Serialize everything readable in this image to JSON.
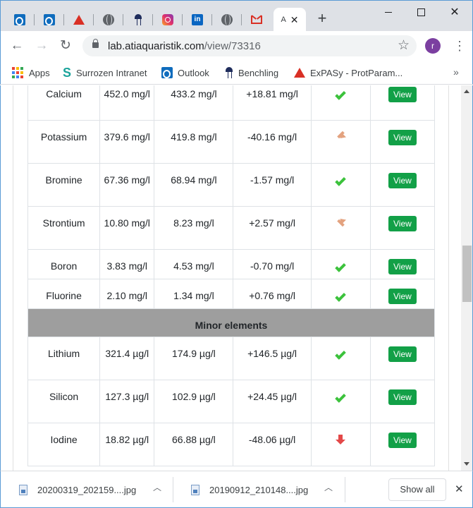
{
  "browser": {
    "tabs": [
      {
        "icon": "outlook-icon"
      },
      {
        "icon": "outlook-icon"
      },
      {
        "icon": "expasy-icon"
      },
      {
        "icon": "globe-icon"
      },
      {
        "icon": "benchling-icon"
      },
      {
        "icon": "instagram-icon"
      },
      {
        "icon": "linkedin-icon"
      },
      {
        "icon": "globe-icon"
      },
      {
        "icon": "gmail-icon"
      },
      {
        "icon": "none",
        "title": "A",
        "active": true
      }
    ],
    "linkedin_glyph": "in",
    "url_host": "lab.atiaquaristik.com",
    "url_path": "/view/73316",
    "profile_initial": "r"
  },
  "bookmarks": {
    "apps": "Apps",
    "items": [
      {
        "label": "Surrozen Intranet",
        "icon": "surrozen-icon"
      },
      {
        "label": "Outlook",
        "icon": "outlook-icon"
      },
      {
        "label": "Benchling",
        "icon": "benchling-icon"
      },
      {
        "label": "ExPASy - ProtParam...",
        "icon": "expasy-icon"
      }
    ],
    "more": "»"
  },
  "table": {
    "view_label": "View",
    "rows": [
      {
        "element": "Calcium",
        "measured": "452.0 mg/l",
        "target": "433.2 mg/l",
        "diff": "+18.81 mg/l",
        "status": "ok"
      },
      {
        "element": "Potassium",
        "measured": "379.6 mg/l",
        "target": "419.8 mg/l",
        "diff": "-40.16 mg/l",
        "status": "warn-down"
      },
      {
        "element": "Bromine",
        "measured": "67.36 mg/l",
        "target": "68.94 mg/l",
        "diff": "-1.57 mg/l",
        "status": "ok"
      },
      {
        "element": "Strontium",
        "measured": "10.80 mg/l",
        "target": "8.23 mg/l",
        "diff": "+2.57 mg/l",
        "status": "warn-up"
      },
      {
        "element": "Boron",
        "measured": "3.83 mg/l",
        "target": "4.53 mg/l",
        "diff": "-0.70 mg/l",
        "status": "ok"
      },
      {
        "element": "Fluorine",
        "measured": "2.10 mg/l",
        "target": "1.34 mg/l",
        "diff": "+0.76 mg/l",
        "status": "ok"
      }
    ],
    "section_title": "Minor elements",
    "minor_rows": [
      {
        "element": "Lithium",
        "measured": "321.4 µg/l",
        "target": "174.9 µg/l",
        "diff": "+146.5 µg/l",
        "status": "ok"
      },
      {
        "element": "Silicon",
        "measured": "127.3 µg/l",
        "target": "102.9 µg/l",
        "diff": "+24.45 µg/l",
        "status": "ok"
      },
      {
        "element": "Iodine",
        "measured": "18.82 µg/l",
        "target": "66.88 µg/l",
        "diff": "-48.06 µg/l",
        "status": "low"
      }
    ]
  },
  "downloads": {
    "items": [
      {
        "filename": "20200319_202159....jpg"
      },
      {
        "filename": "20190912_210148....jpg"
      }
    ],
    "show_all": "Show all"
  },
  "colors": {
    "view_button": "#12a047",
    "ok_check": "#3cc23c",
    "warn_arrow": "#e3a27f",
    "low_arrow": "#e34848",
    "section_header": "#9e9e9e"
  }
}
